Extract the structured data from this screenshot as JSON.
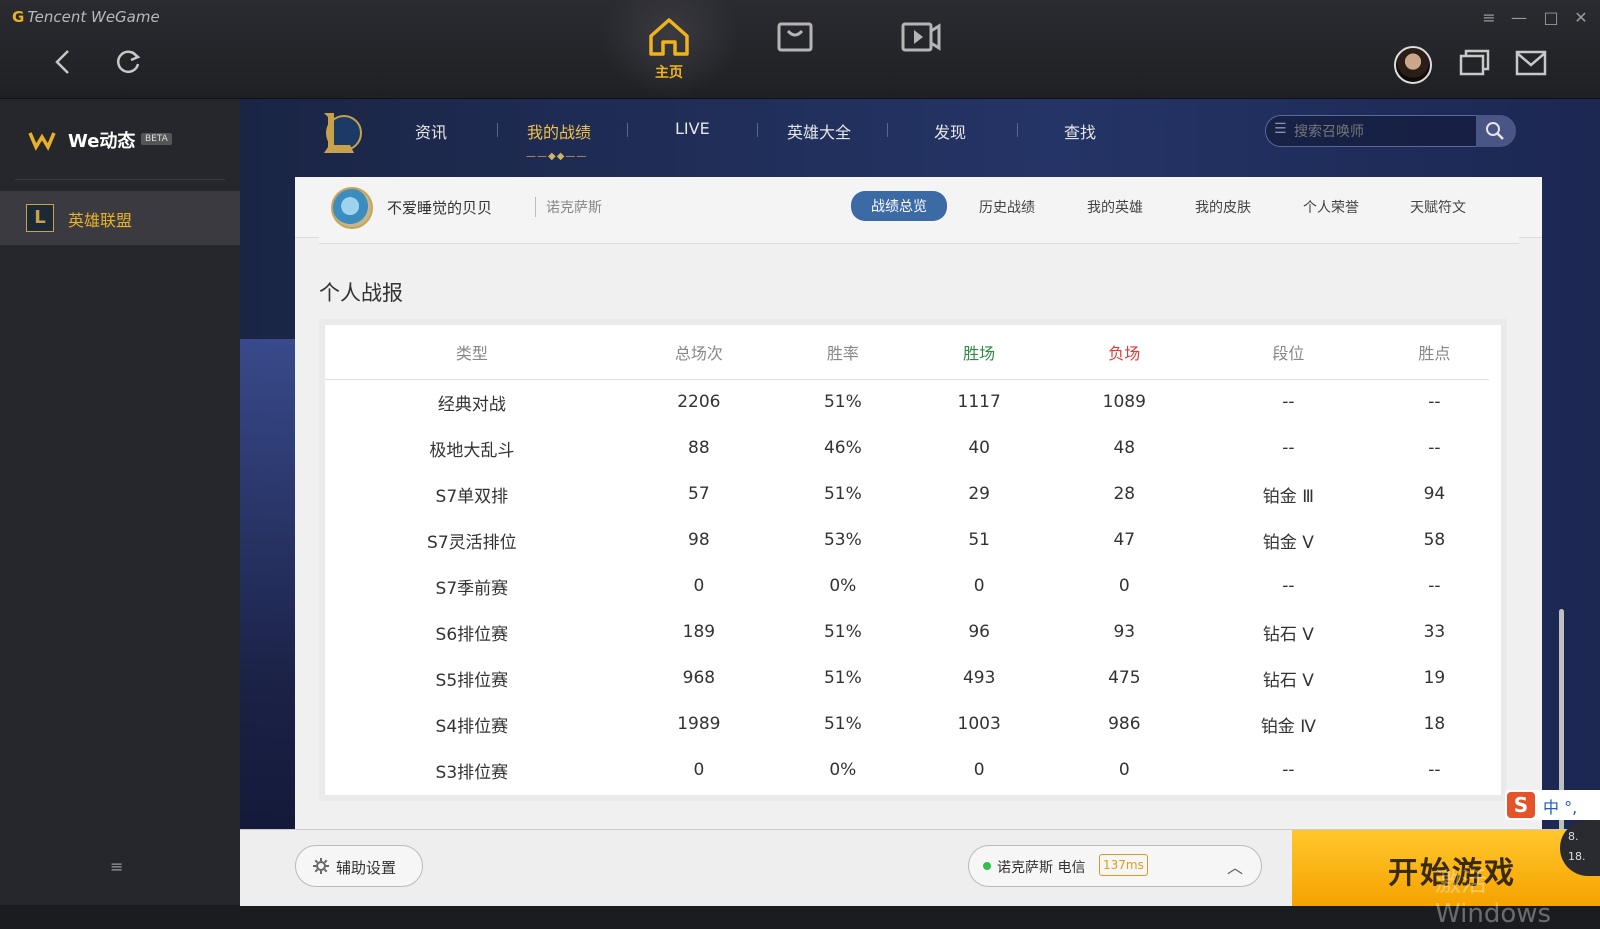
{
  "app": {
    "brand": "Tencent WeGame"
  },
  "topnav": {
    "home_label": "主页",
    "window_controls": [
      "≡",
      "—",
      "□",
      "✕"
    ]
  },
  "sidebar": {
    "title": "We动态",
    "badge": "BETA",
    "items": [
      {
        "label": "英雄联盟",
        "icon": "lol-icon"
      }
    ],
    "menu_icon": "≡"
  },
  "lol_nav": {
    "items": [
      "资讯",
      "我的战绩",
      "LIVE",
      "英雄大全",
      "发现",
      "查找"
    ],
    "active": "我的战绩",
    "search_placeholder": "搜索召唤师"
  },
  "profile": {
    "name": "不爱睡觉的贝贝",
    "server": "诺克萨斯",
    "tabs": [
      "战绩总览",
      "历史战绩",
      "我的英雄",
      "我的皮肤",
      "个人荣誉",
      "天赋符文"
    ],
    "active_tab": "战绩总览"
  },
  "stats": {
    "title": "个人战报",
    "headers": [
      "类型",
      "总场次",
      "胜率",
      "胜场",
      "负场",
      "段位",
      "胜点"
    ],
    "rows": [
      [
        "经典对战",
        "2206",
        "51%",
        "1117",
        "1089",
        "--",
        "--"
      ],
      [
        "极地大乱斗",
        "88",
        "46%",
        "40",
        "48",
        "--",
        "--"
      ],
      [
        "S7单双排",
        "57",
        "51%",
        "29",
        "28",
        "铂金 Ⅲ",
        "94"
      ],
      [
        "S7灵活排位",
        "98",
        "53%",
        "51",
        "47",
        "铂金 Ⅴ",
        "58"
      ],
      [
        "S7季前赛",
        "0",
        "0%",
        "0",
        "0",
        "--",
        "--"
      ],
      [
        "S6排位赛",
        "189",
        "51%",
        "96",
        "93",
        "钻石 Ⅴ",
        "33"
      ],
      [
        "S5排位赛",
        "968",
        "51%",
        "493",
        "475",
        "钻石 Ⅴ",
        "19"
      ],
      [
        "S4排位赛",
        "1989",
        "51%",
        "1003",
        "986",
        "铂金 Ⅳ",
        "18"
      ],
      [
        "S3排位赛",
        "0",
        "0%",
        "0",
        "0",
        "--",
        "--"
      ]
    ]
  },
  "bottom": {
    "assist_label": "辅助设置",
    "server_label": "诺克萨斯 电信",
    "ping": "137ms",
    "start_label": "开始游戏",
    "watermark": "激活 Windows"
  },
  "tray": {
    "ime_label": "中 °,",
    "net_up": "8.",
    "net_down": "18."
  },
  "colors": {
    "accent": "#f0b31d",
    "win": "#2f8a43",
    "lose": "#e03a3a",
    "start": "#ffc72c"
  }
}
